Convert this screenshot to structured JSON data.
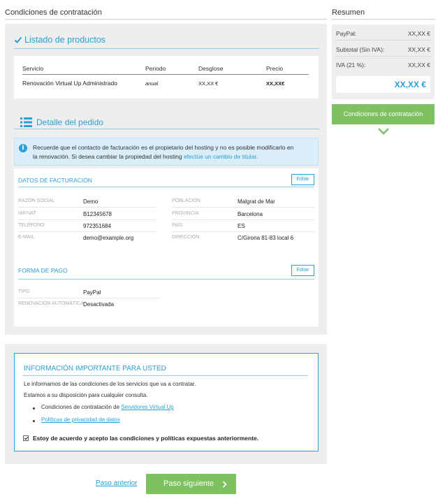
{
  "header": {
    "title": "Condiciones de contratación"
  },
  "summary": {
    "title": "Resumen",
    "rows": [
      {
        "label": "PayPal:",
        "value": "XX,XX €"
      },
      {
        "label": "Subtotal (Sin IVA):",
        "value": "XX,XX €"
      },
      {
        "label": "IVA (21 %):",
        "value": "XX,XX €"
      }
    ],
    "total": "XX,XX €",
    "button_label": "Condiciones de contratación"
  },
  "products": {
    "title": "Listado de productos",
    "columns": [
      "Servicio",
      "Periodo",
      "Desglose",
      "Precio"
    ],
    "rows": [
      {
        "servicio": "Renovación Virtual Up Administrado",
        "periodo": "anual",
        "desglose": "XX,XX €",
        "precio": "XX,XX€"
      }
    ]
  },
  "order": {
    "title": "Detalle del pedido",
    "info_line1": "Recuerde que el contacto de facturación es el propietario del hosting y no es posible modificarlo en",
    "info_line2_text": "la renovación. Si desea cambiar la propiedad del hosting ",
    "info_line2_link": "efectúe un cambio de titular",
    "info_line2_end": "."
  },
  "billing": {
    "title": "DATOS DE FACTURACIÓN",
    "edit_label": "Editar",
    "left": [
      {
        "label": "RAZÓN SOCIAL",
        "value": "Demo"
      },
      {
        "label": "NIF/VAT",
        "value": "B12345678"
      },
      {
        "label": "TELÉFONO",
        "value": "972351684"
      },
      {
        "label": "E-MAIL",
        "value": "demo@example.org"
      }
    ],
    "right": [
      {
        "label": "POBLACIÓN",
        "value": "Malgrat de Mar"
      },
      {
        "label": "PROVINCIA",
        "value": "Barcelona"
      },
      {
        "label": "PAÍS",
        "value": "ES"
      },
      {
        "label": "DIRECCIÓN",
        "value": "C/Girona 81-83 local 6"
      }
    ]
  },
  "payment": {
    "title": "FORMA DE PAGO",
    "edit_label": "Editar",
    "rows": [
      {
        "label": "TIPO",
        "value": "PayPal"
      },
      {
        "label": "RENOVACIÓN AUTOMÁTICA",
        "value": "Desactivada"
      }
    ]
  },
  "important": {
    "title": "INFORMACIÓN IMPORTANTE PARA USTED",
    "line1": "Le informamos de las condiciones de los servicios que va a contratar.",
    "line2": "Estamos a su disposición para cualquier consulta.",
    "bullet1_text": "Condiciones de contratación de ",
    "bullet1_link": "Servidores Virtual Up",
    "bullet2_link": "Políticas de privacidad de datos",
    "agree": "Estoy de acuerdo y acepto las condiciones y políticas expuestas anteriormente.",
    "agree_checked": true
  },
  "nav": {
    "prev_label": "Paso anterior",
    "next_label": "Paso siguiente"
  },
  "colors": {
    "accent": "#2a9fd8",
    "button_green": "#7dc160",
    "panel_gray": "#eeeeee"
  },
  "icons": [
    "check-icon",
    "list-icon",
    "info-icon",
    "chevron-down-icon",
    "chevron-right-icon"
  ]
}
